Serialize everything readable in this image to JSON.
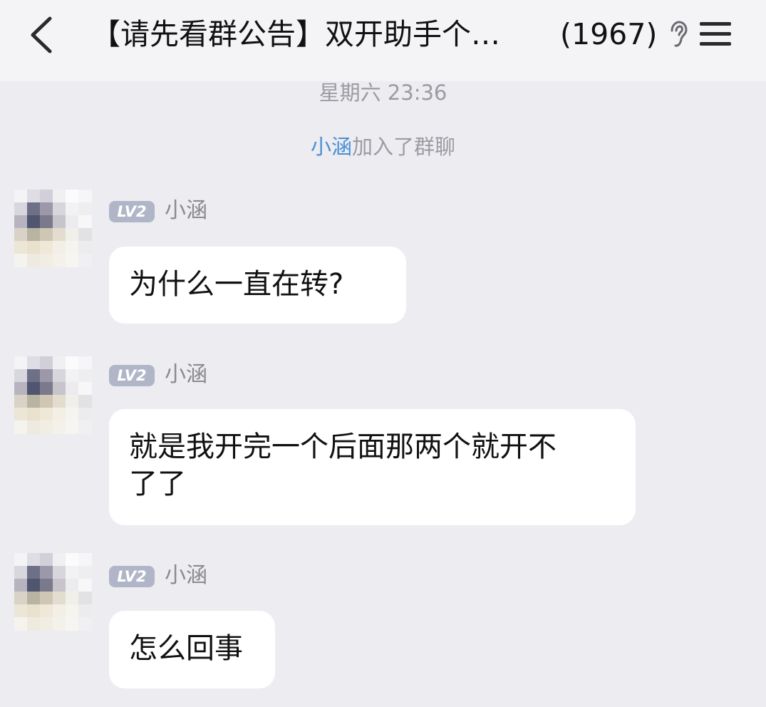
{
  "header": {
    "title": "【请先看群公告】双开助手个…",
    "member_count": "(1967)",
    "back_icon": "chevron-left-icon",
    "earpiece_icon": "ear-icon",
    "menu_icon": "hamburger-menu-icon"
  },
  "timestamp": "星期六 23:36",
  "system_message": {
    "member_name": "小涵",
    "action": "加入了群聊",
    "link_color": "#4a8fd6"
  },
  "messages": [
    {
      "level": "LV2",
      "sender": "小涵",
      "text": "为什么一直在转?"
    },
    {
      "level": "LV2",
      "sender": "小涵",
      "text": "就是我开完一个后面那两个就开不\n了了"
    },
    {
      "level": "LV2",
      "sender": "小涵",
      "text": "怎么回事"
    }
  ],
  "colors": {
    "background": "#ececf1",
    "header_background": "#f4f4f7",
    "bubble": "#ffffff",
    "level_badge": "#b0b6c8",
    "meta_text": "#9b9ba1"
  }
}
